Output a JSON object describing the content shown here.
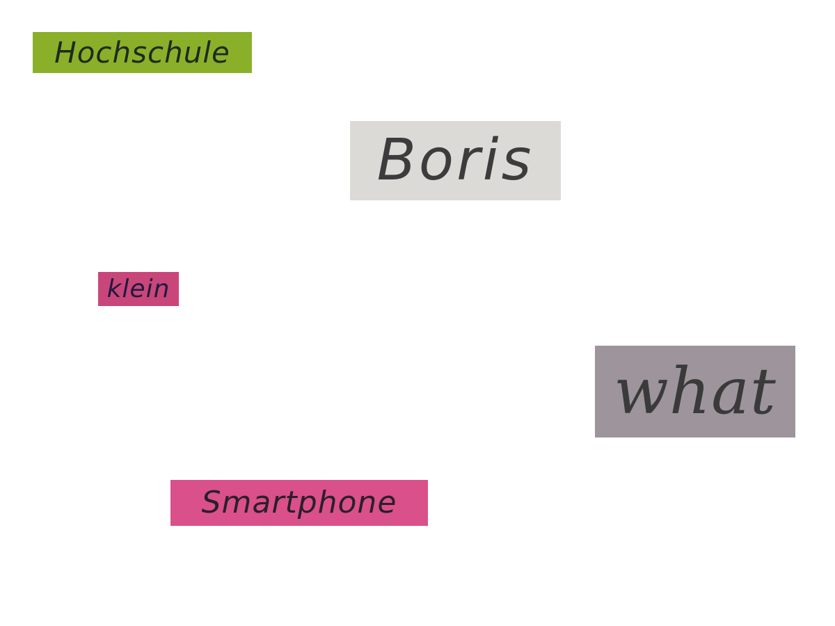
{
  "words": [
    {
      "text": "Hochschule",
      "paper_color": "#8ab02a",
      "ink_color": "#1f2a1f"
    },
    {
      "text": "Boris",
      "paper_color": "#dcdad6",
      "ink_color": "#3c3c3c"
    },
    {
      "text": "klein",
      "paper_color": "#c9467a",
      "ink_color": "#1e1a40"
    },
    {
      "text": "what",
      "paper_color": "#9d959b",
      "ink_color": "#3a3a3a"
    },
    {
      "text": "Smartphone",
      "paper_color": "#d9508a",
      "ink_color": "#2a1f2a"
    }
  ]
}
